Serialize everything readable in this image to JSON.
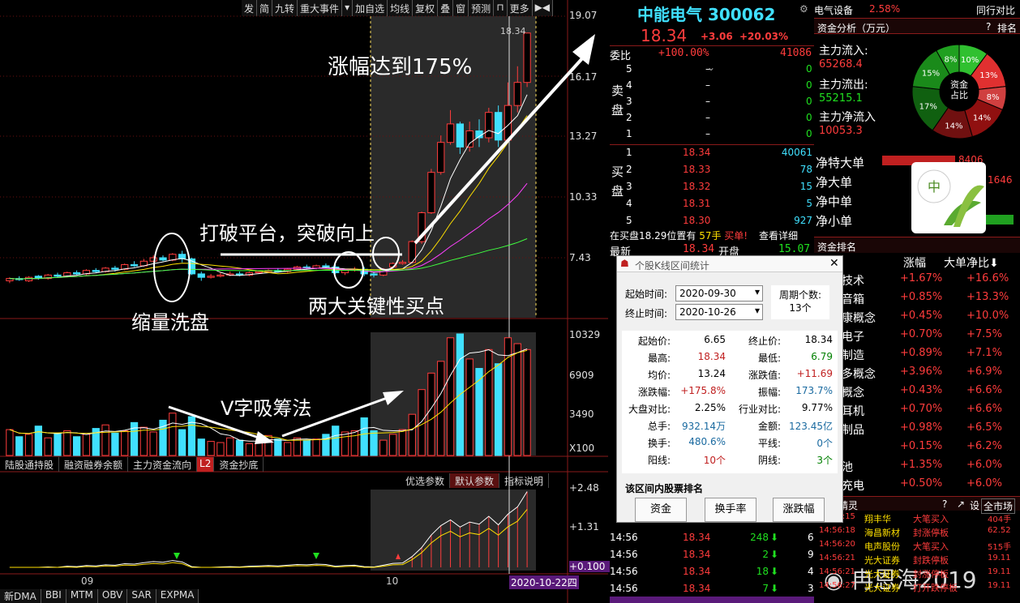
{
  "toolbar": [
    "发",
    "简",
    "九转",
    "重大事件",
    "加自选",
    "均线",
    "复权",
    "叠",
    "窗",
    "预测",
    "更多"
  ],
  "price_axis": [
    "19.07",
    "16.17",
    "13.27",
    "10.33",
    "7.43"
  ],
  "vol_axis": [
    "10329",
    "6909",
    "3490",
    "X100"
  ],
  "macd_axis": [
    "+2.48",
    "+1.31",
    "+0.100"
  ],
  "latest_label": "18.34",
  "x_labels": {
    "sep": "09",
    "oct": "10",
    "date": "2020-10-22四"
  },
  "panel_tabs": [
    "陆股通持股",
    "融资融券余额",
    "主力资金流向",
    "L2",
    "资金抄底"
  ],
  "panel_tabs2": [
    "优选参数",
    "默认参数",
    "指标说明"
  ],
  "bottom_tabs": [
    "新DMA",
    "BBI",
    "MTM",
    "OBV",
    "SAR",
    "EXPMA"
  ],
  "annotations": {
    "a1": "涨幅达到175%",
    "a2": "打破平台，突破向上",
    "a3": "缩量洗盘",
    "a4": "两大关键性买点",
    "a5": "V字吸筹法"
  },
  "stock": {
    "name": "中能电气",
    "code": "300062",
    "price": "18.34",
    "change": "+3.06",
    "pct": "+20.03%"
  },
  "industry": {
    "name": "电气设备",
    "pct": "2.58%",
    "link": "同行对比"
  },
  "weibi": {
    "label": "委比",
    "pct": "+100.00%",
    "val": "41086"
  },
  "sell": [
    {
      "n": "5",
      "p": "–",
      "v": "0"
    },
    {
      "n": "4",
      "p": "–",
      "v": "0"
    },
    {
      "n": "3",
      "p": "–",
      "v": "0"
    },
    {
      "n": "2",
      "p": "–",
      "v": "0"
    },
    {
      "n": "1",
      "p": "–",
      "v": "0"
    }
  ],
  "buy": [
    {
      "n": "1",
      "p": "18.34",
      "v": "40061"
    },
    {
      "n": "2",
      "p": "18.33",
      "v": "78"
    },
    {
      "n": "3",
      "p": "18.32",
      "v": "15"
    },
    {
      "n": "4",
      "p": "18.31",
      "v": "5"
    },
    {
      "n": "5",
      "p": "18.30",
      "v": "927"
    }
  ],
  "sell_label": "卖盘",
  "buy_label": "买盘",
  "buy_note": "在买盘18.29位置有",
  "buy_note2": "57手",
  "buy_note3": "买单!",
  "buy_note4": "查看详细",
  "flow": {
    "title": "资金分析（万元）",
    "help": "?",
    "rank": "排名",
    "in_l": "主力流入:",
    "in_v": "65268.4",
    "out_l": "主力流出:",
    "out_v": "55215.1",
    "net_l": "主力净流入",
    "net_v": "10053.3",
    "pie_label": "资金占比",
    "pie": [
      {
        "v": "10%",
        "c": "#30c030"
      },
      {
        "v": "13%",
        "c": "#e03030"
      },
      {
        "v": "8%",
        "c": "#d04040"
      },
      {
        "v": "14%",
        "c": "#901010"
      },
      {
        "v": "14%",
        "c": "#701010"
      },
      {
        "v": "17%",
        "c": "#106010"
      },
      {
        "v": "15%",
        "c": "#1a8a1a"
      },
      {
        "v": "8%",
        "c": "#20a020"
      }
    ]
  },
  "order_types": [
    "净特大单",
    "净大单",
    "净中单",
    "净小单"
  ],
  "big_val": "8406",
  "big_val2": "1646",
  "sector": {
    "title": "资金排名",
    "h1": "涨幅",
    "h2": "大单净比",
    "rows": [
      {
        "n": "技术",
        "a": "+1.67%",
        "b": "+16.6%"
      },
      {
        "n": "音箱",
        "a": "+0.85%",
        "b": "+13.3%"
      },
      {
        "n": "康概念",
        "a": "+0.45%",
        "b": "+10.0%"
      },
      {
        "n": "电子",
        "a": "+0.70%",
        "b": "+7.5%"
      },
      {
        "n": "制造",
        "a": "+0.89%",
        "b": "+7.1%"
      },
      {
        "n": "多概念",
        "a": "+3.96%",
        "b": "+6.9%"
      },
      {
        "n": "概念",
        "a": "+0.43%",
        "b": "+6.6%"
      },
      {
        "n": "耳机",
        "a": "+0.70%",
        "b": "+6.6%"
      },
      {
        "n": "制品",
        "a": "+0.98%",
        "b": "+6.5%"
      },
      {
        "n": "",
        "a": "+0.15%",
        "b": "+6.2%"
      },
      {
        "n": "池",
        "a": "+1.35%",
        "b": "+6.0%"
      },
      {
        "n": "充电",
        "a": "+0.50%",
        "b": "+6.0%"
      }
    ]
  },
  "latest": {
    "l": "最新",
    "p": "18.34",
    "o": "开盘",
    "ov": "15.07"
  },
  "ticks": [
    {
      "t": "14:56",
      "p": "18.34",
      "v": "248",
      "x": "6"
    },
    {
      "t": "14:56",
      "p": "18.34",
      "v": "2",
      "x": "9"
    },
    {
      "t": "14:56",
      "p": "18.34",
      "v": "18",
      "x": "4"
    },
    {
      "t": "14:56",
      "p": "18.34",
      "v": "7",
      "x": "3"
    }
  ],
  "news": {
    "title": "精灵",
    "market": "全市场",
    "rows": [
      {
        "t": "14:56:15",
        "s": "翔丰华",
        "e": "大笔买入",
        "v": "404手"
      },
      {
        "t": "14:56:18",
        "s": "海昌新材",
        "e": "封涨停板",
        "v": "62.52"
      },
      {
        "t": "14:56:20",
        "s": "电声股份",
        "e": "大笔买入",
        "v": "515手"
      },
      {
        "t": "14:56:21",
        "s": "光大证券",
        "e": "封跌停板",
        "v": "19.11"
      },
      {
        "t": "14:56:21",
        "s": "光大证券",
        "e": "封涨停板",
        "v": "19.11"
      },
      {
        "t": "14:56:27",
        "s": "光大证券",
        "e": "打开跌停板",
        "v": "19.11"
      }
    ]
  },
  "dialog": {
    "title": "个股K线区间统计",
    "start_l": "起始时间:",
    "start": "2020-09-30",
    "end_l": "终止时间:",
    "end": "2020-10-26",
    "cycle_l": "周期个数:",
    "cycle": "13个",
    "stats": [
      [
        "起始价:",
        "6.65",
        "终止价:",
        "18.34"
      ],
      [
        "最高:",
        "18.34",
        "最低:",
        "6.79"
      ],
      [
        "均价:",
        "13.24",
        "涨跌值:",
        "+11.69"
      ],
      [
        "涨跌幅:",
        "+175.8%",
        "振幅:",
        "173.7%"
      ],
      [
        "大盘对比:",
        "2.25%",
        "行业对比:",
        "9.77%"
      ],
      [
        "总手:",
        "932.14万",
        "金额:",
        "123.45亿"
      ],
      [
        "换手:",
        "480.6%",
        "平线:",
        "0个"
      ],
      [
        "阳线:",
        "10个",
        "阴线:",
        "3个"
      ]
    ],
    "rank_title": "该区间内股票排名",
    "btns": [
      "资金",
      "换手率",
      "涨跌幅"
    ]
  },
  "watermark": "冉恩海2019",
  "chart_data": {
    "type": "candlestick",
    "ylim": [
      6.0,
      19.07
    ],
    "close_last": 18.34
  }
}
